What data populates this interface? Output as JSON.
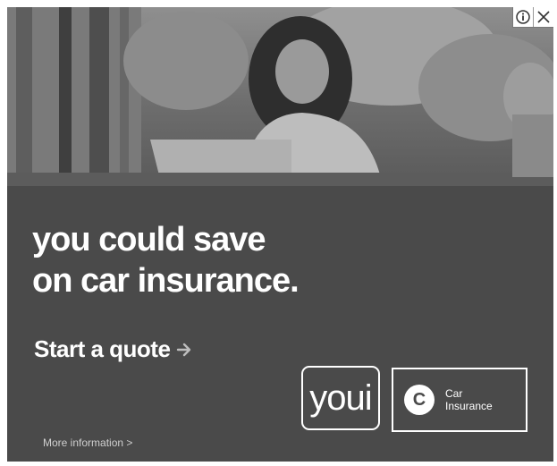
{
  "ad": {
    "headline": [
      "you could save",
      "on car insurance."
    ],
    "cta_label": "Start a quote",
    "cta_icon": "arrow-right-icon",
    "brand": "youi",
    "badge": {
      "icon_letter": "C",
      "label_line1": "Car",
      "label_line2": "Insurance"
    },
    "more_info": "More information >",
    "controls": {
      "info_icon": "info-icon",
      "close_icon": "close-icon"
    }
  },
  "colors": {
    "background": "#4a4a4a",
    "text": "#ffffff",
    "arrow": "#bdbdbd"
  }
}
